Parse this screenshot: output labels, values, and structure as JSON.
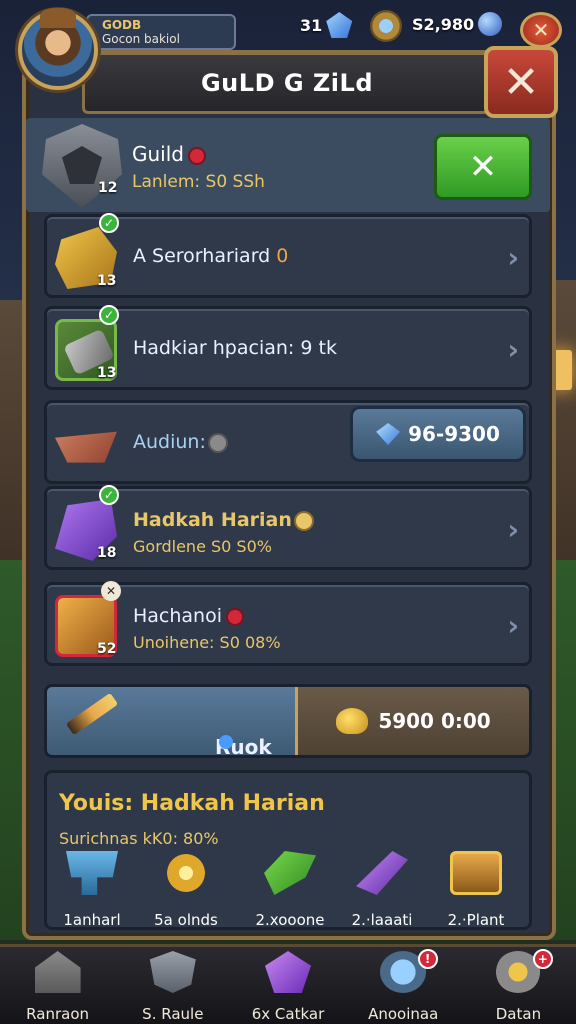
{
  "player": {
    "line1": "GODB",
    "line2": "Gocon bakiol"
  },
  "currency": {
    "gems": "31",
    "gold": "S2,980"
  },
  "title": "GuLD G ZiLd",
  "guild": {
    "name": "Guild",
    "subtitle": "Lanlem: S0 SSh",
    "level": "12"
  },
  "rows": [
    {
      "label": "A Serorhariard",
      "extra": "0",
      "level": "13"
    },
    {
      "label": "Hadkiar hpacian: 9 tk",
      "level": "13"
    },
    {
      "label": "Audiun:",
      "button": "96-9300"
    },
    {
      "label": "Hadkah Harian",
      "sub": "Gordlene S0 S0%",
      "level": "18"
    },
    {
      "label": "Hachanoi",
      "sub": "Unoihene: S0 08%",
      "level": "52"
    }
  ],
  "split": {
    "left": "Ruok",
    "right": "5900 0:00"
  },
  "summary": {
    "heading": "Youis: Hadkah Harian",
    "sub": "Surichnas kK0: 80%",
    "rewards": [
      {
        "label": "1anharl",
        "icon": "anvil-icon"
      },
      {
        "label": "5a olnds",
        "icon": "ring-icon"
      },
      {
        "label": "2.xooone",
        "icon": "leaf-icon"
      },
      {
        "label": "2.·laaati",
        "icon": "staff-icon"
      },
      {
        "label": "2.·Plant",
        "icon": "chest-icon"
      }
    ]
  },
  "nav": [
    {
      "label": "Ranraon",
      "icon": "house-icon"
    },
    {
      "label": "S. Raule",
      "icon": "shield-icon"
    },
    {
      "label": "6x Catkar",
      "icon": "gem-icon"
    },
    {
      "label": "Anooinaa",
      "icon": "compass-icon"
    },
    {
      "label": "Datan",
      "icon": "gear-icon"
    }
  ],
  "colors": {
    "accent_gold": "#e8c76a",
    "panel": "#2a3242",
    "green_button": "#2f9a24",
    "close_red": "#c8483a"
  }
}
